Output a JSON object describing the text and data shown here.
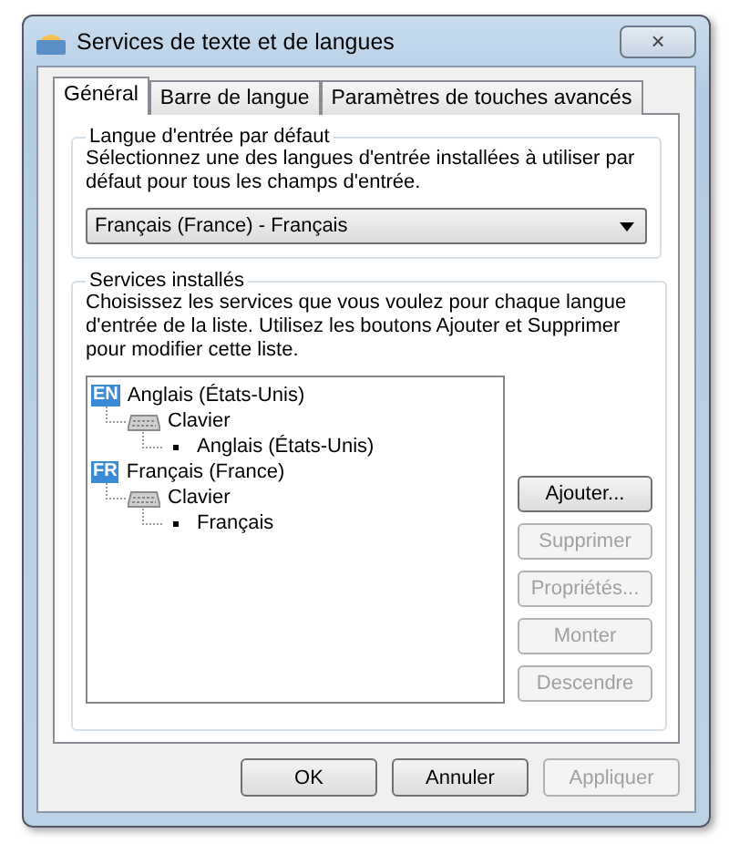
{
  "window": {
    "title": "Services de texte et de langues",
    "close": "×"
  },
  "tabs": [
    {
      "label": "Général",
      "selected": true
    },
    {
      "label": "Barre de langue",
      "selected": false
    },
    {
      "label": "Paramètres de touches avancés",
      "selected": false
    }
  ],
  "default_language": {
    "legend": "Langue d'entrée par défaut",
    "description": "Sélectionnez une des langues d'entrée installées à utiliser par défaut pour tous les champs d'entrée.",
    "dropdown": {
      "value": "Français (France) - Français"
    }
  },
  "installed_services": {
    "legend": "Services installés",
    "description": "Choisissez les services que vous voulez pour chaque langue d'entrée de la liste. Utilisez les boutons Ajouter et Supprimer pour modifier cette liste.",
    "tree": [
      {
        "kind": "language",
        "badge": "EN",
        "label": "Anglais (États-Unis)",
        "children": [
          {
            "kind": "category",
            "label": "Clavier",
            "children": [
              {
                "kind": "service",
                "label": "Anglais (États-Unis)"
              }
            ]
          }
        ]
      },
      {
        "kind": "language",
        "badge": "FR",
        "label": "Français (France)",
        "children": [
          {
            "kind": "category",
            "label": "Clavier",
            "children": [
              {
                "kind": "service",
                "label": "Français"
              }
            ]
          }
        ]
      }
    ],
    "buttons": [
      {
        "label": "Ajouter...",
        "disabled": false
      },
      {
        "label": "Supprimer",
        "disabled": true
      },
      {
        "label": "Propriétés...",
        "disabled": true
      },
      {
        "label": "Monter",
        "disabled": true
      },
      {
        "label": "Descendre",
        "disabled": true
      }
    ]
  },
  "footer_buttons": [
    {
      "label": "OK",
      "disabled": false
    },
    {
      "label": "Annuler",
      "disabled": false
    },
    {
      "label": "Appliquer",
      "disabled": true
    }
  ]
}
